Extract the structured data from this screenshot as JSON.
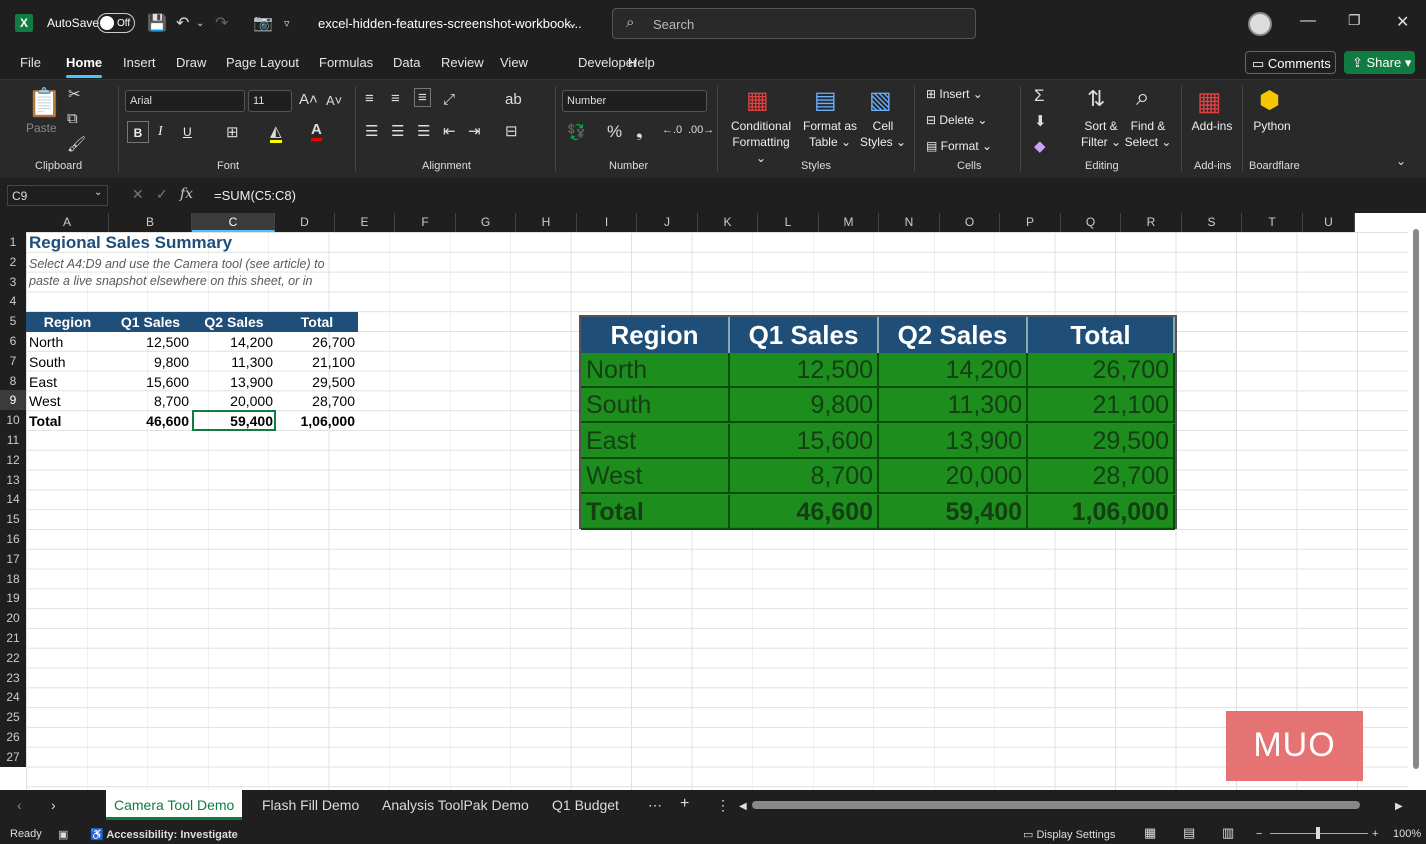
{
  "app": {
    "autosave_label": "AutoSave",
    "autosave_state": "Off",
    "doc_title": "excel-hidden-features-screenshot-workbook...",
    "search_placeholder": "Search",
    "comments_label": "Comments",
    "share_label": "Share",
    "logo_letter": "X"
  },
  "menu": [
    "File",
    "Home",
    "Insert",
    "Draw",
    "Page Layout",
    "Formulas",
    "Data",
    "Review",
    "View",
    "Developer",
    "Help"
  ],
  "ribbon": {
    "clipboard": {
      "label": "Clipboard",
      "paste": "Paste"
    },
    "font": {
      "label": "Font",
      "name": "Arial",
      "size": "11",
      "bold": "B",
      "italic": "I",
      "underline": "U"
    },
    "alignment": {
      "label": "Alignment"
    },
    "number": {
      "label": "Number",
      "format": "Number"
    },
    "styles": {
      "label": "Styles",
      "conditional": [
        "Conditional",
        "Formatting"
      ],
      "format_table": [
        "Format as",
        "Table"
      ],
      "cell_styles": [
        "Cell",
        "Styles"
      ]
    },
    "cells": {
      "label": "Cells",
      "insert": "Insert",
      "delete": "Delete",
      "format": "Format"
    },
    "editing": {
      "label": "Editing",
      "sort": [
        "Sort &",
        "Filter"
      ],
      "find": [
        "Find &",
        "Select"
      ]
    },
    "addins": {
      "label": "Add-ins",
      "addins_btn": "Add-ins"
    },
    "boardflare": {
      "label": "Boardflare",
      "python": "Python"
    }
  },
  "formula_bar": {
    "name_box": "C9",
    "formula": "=SUM(C5:C8)",
    "fx": "fx"
  },
  "columns": [
    "A",
    "B",
    "C",
    "D",
    "E",
    "F",
    "G",
    "H",
    "I",
    "J",
    "K",
    "L",
    "M",
    "N",
    "O",
    "P",
    "Q",
    "R",
    "S",
    "T",
    "U"
  ],
  "rows": [
    "1",
    "2",
    "3",
    "4",
    "5",
    "6",
    "7",
    "8",
    "9",
    "10",
    "11",
    "12",
    "13",
    "14",
    "15",
    "16",
    "17",
    "18",
    "19",
    "20",
    "21",
    "22",
    "23",
    "24",
    "25",
    "26",
    "27"
  ],
  "sheet": {
    "title": "Regional Sales Summary",
    "subtitle_line1": "Select A4:D9 and use the Camera tool (see article) to",
    "subtitle_line2": "paste a live snapshot elsewhere on this sheet, or in",
    "headers": [
      "Region",
      "Q1 Sales",
      "Q2 Sales",
      "Total"
    ],
    "data": [
      [
        "North",
        "12,500",
        "14,200",
        "26,700"
      ],
      [
        "South",
        "9,800",
        "11,300",
        "21,100"
      ],
      [
        "East",
        "15,600",
        "13,900",
        "29,500"
      ],
      [
        "West",
        "8,700",
        "20,000",
        "28,700"
      ],
      [
        "Total",
        "46,600",
        "59,400",
        "1,06,000"
      ]
    ]
  },
  "watermark": "MUO",
  "tabs": [
    "Camera Tool Demo",
    "Flash Fill Demo",
    "Analysis ToolPak Demo",
    "Q1 Budget"
  ],
  "status": {
    "ready": "Ready",
    "accessibility": "Accessibility: Investigate",
    "display": "Display Settings",
    "zoom": "100%"
  },
  "colors": {
    "accent": "#4cc2ff",
    "excel_green": "#107c41",
    "table_header": "#1f4e79",
    "snapshot_fill": "#1d8d1d"
  }
}
